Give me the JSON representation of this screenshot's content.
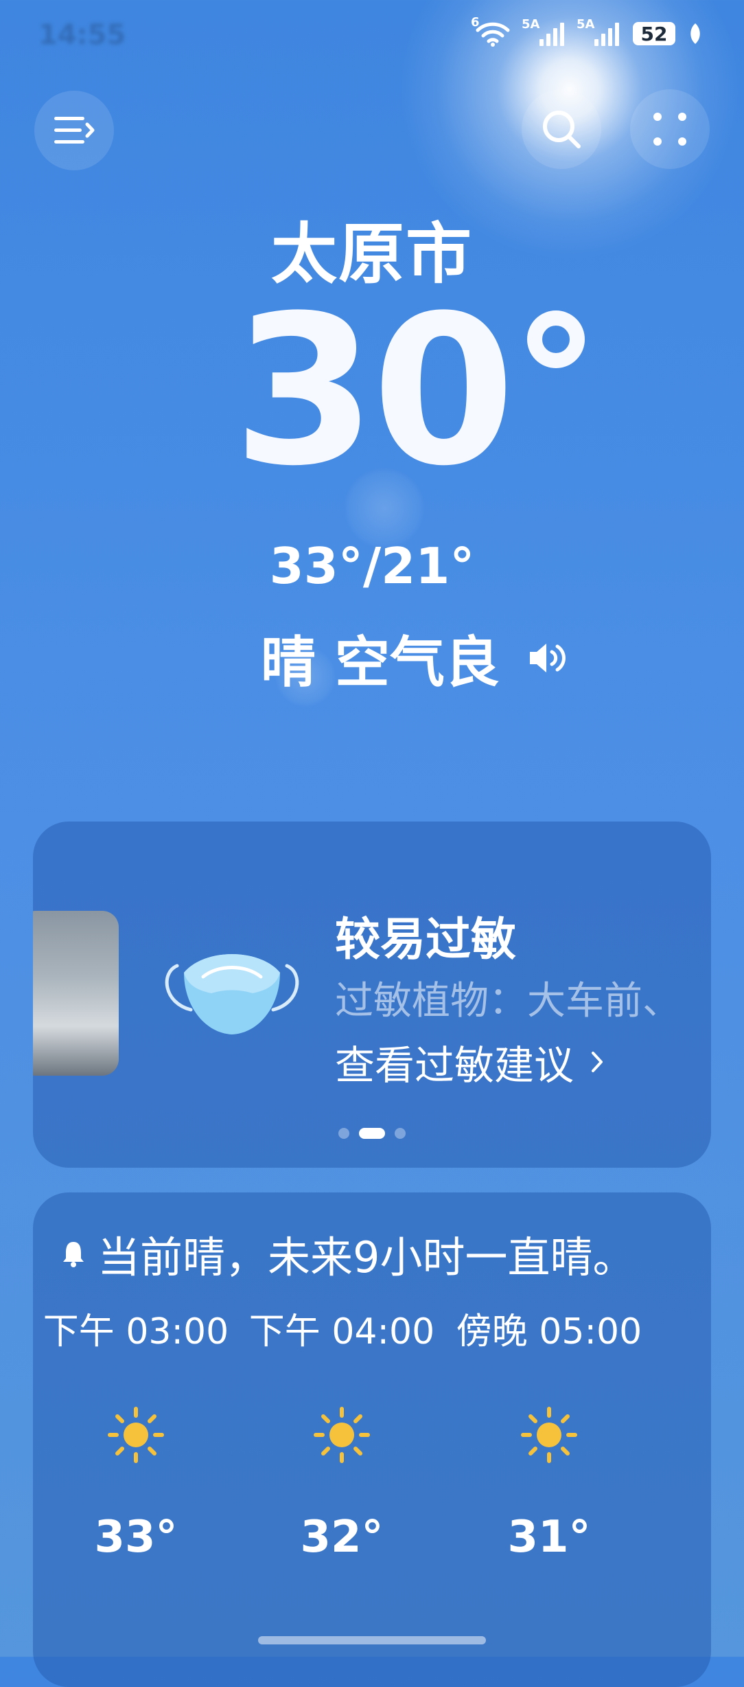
{
  "status_bar": {
    "time": "14:55",
    "wifi_tag": "6",
    "sim1_tag": "5A",
    "sim2_tag": "5A",
    "battery": "52"
  },
  "header": {
    "menu_icon": "menu-icon",
    "search_icon": "search-icon",
    "more_icon": "grid-dots-icon"
  },
  "current": {
    "city": "太原市",
    "temperature": "30",
    "range": "33°/21°",
    "condition": "晴 空气良",
    "sound_icon": "speaker-icon"
  },
  "allergy_card": {
    "title": "较易过敏",
    "subtitle": "过敏植物：大车前、",
    "link": "查看过敏建议",
    "pager": {
      "count": 3,
      "active": 1
    }
  },
  "hourly": {
    "summary": "当前晴，未来9小时一直晴。",
    "items": [
      {
        "time": "下午 03:00",
        "icon": "sun-icon",
        "temp": "33°"
      },
      {
        "time": "下午 04:00",
        "icon": "sun-icon",
        "temp": "32°"
      },
      {
        "time": "傍晚 05:00",
        "icon": "sun-icon",
        "temp": "31°"
      }
    ]
  },
  "colors": {
    "bg_top": "#3f86e0",
    "card": "#2f6bc0",
    "sun": "#f7c23b"
  }
}
